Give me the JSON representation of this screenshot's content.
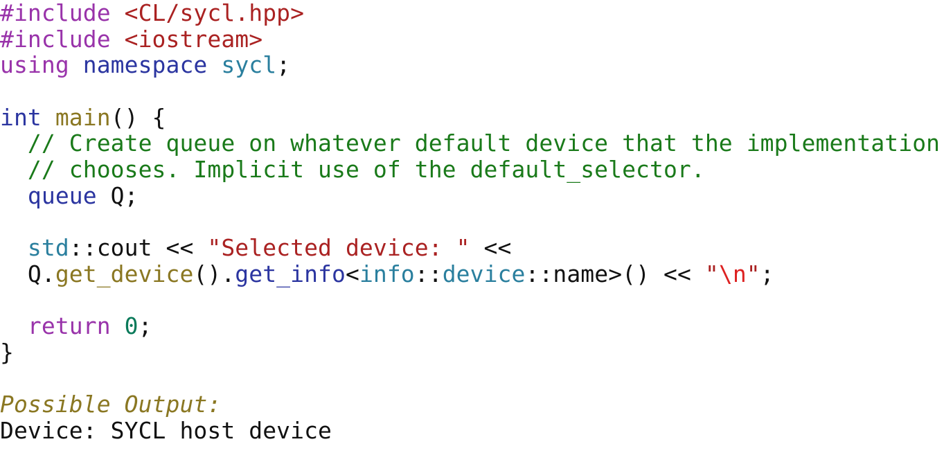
{
  "listing": {
    "language": "cpp",
    "background": "#ffffff",
    "palette": {
      "preprocessor": "#9933aa",
      "keyword": "#9933aa",
      "include_path": "#aa2222",
      "string": "#aa2222",
      "escape": "#dd2222",
      "type": "#2b35a0",
      "namespace": "#2a7f9e",
      "comment": "#1a7a1a",
      "function": "#8a7722",
      "number": "#0a7a5a",
      "plain": "#111111",
      "caption": "#8a7722",
      "output": "#111111"
    },
    "lines": [
      {
        "index": 1,
        "text": "#include <CL/sycl.hpp>",
        "tokens": [
          {
            "t": "#include",
            "c": "t-pre"
          },
          {
            "t": " ",
            "c": "t-plain"
          },
          {
            "t": "<CL/sycl.hpp>",
            "c": "t-inc"
          }
        ]
      },
      {
        "index": 2,
        "text": "#include <iostream>",
        "tokens": [
          {
            "t": "#include",
            "c": "t-pre"
          },
          {
            "t": " ",
            "c": "t-plain"
          },
          {
            "t": "<iostream>",
            "c": "t-inc"
          }
        ]
      },
      {
        "index": 3,
        "text": "using namespace sycl;",
        "tokens": [
          {
            "t": "using",
            "c": "t-kw"
          },
          {
            "t": " ",
            "c": "t-plain"
          },
          {
            "t": "namespace",
            "c": "t-type"
          },
          {
            "t": " ",
            "c": "t-plain"
          },
          {
            "t": "sycl",
            "c": "t-ns"
          },
          {
            "t": ";",
            "c": "t-plain"
          }
        ]
      },
      {
        "index": 4,
        "text": "",
        "tokens": [
          {
            "t": " ",
            "c": "t-blank"
          }
        ]
      },
      {
        "index": 5,
        "text": "int main() {",
        "tokens": [
          {
            "t": "int",
            "c": "t-type"
          },
          {
            "t": " ",
            "c": "t-plain"
          },
          {
            "t": "main",
            "c": "t-fn"
          },
          {
            "t": "() {",
            "c": "t-plain"
          }
        ]
      },
      {
        "index": 6,
        "text": "  // Create queue on whatever default device that the implementation",
        "tokens": [
          {
            "t": "  ",
            "c": "t-plain"
          },
          {
            "t": "// Create queue on whatever default device that the implementation",
            "c": "t-cmt"
          }
        ]
      },
      {
        "index": 7,
        "text": "  // chooses. Implicit use of the default_selector.",
        "tokens": [
          {
            "t": "  ",
            "c": "t-plain"
          },
          {
            "t": "// chooses. Implicit use of the default_selector.",
            "c": "t-cmt"
          }
        ]
      },
      {
        "index": 8,
        "text": "  queue Q;",
        "tokens": [
          {
            "t": "  ",
            "c": "t-plain"
          },
          {
            "t": "queue",
            "c": "t-type"
          },
          {
            "t": " Q;",
            "c": "t-plain"
          }
        ]
      },
      {
        "index": 9,
        "text": "",
        "tokens": [
          {
            "t": " ",
            "c": "t-blank"
          }
        ]
      },
      {
        "index": 10,
        "text": "  std::cout << \"Selected device: \" <<",
        "tokens": [
          {
            "t": "  ",
            "c": "t-plain"
          },
          {
            "t": "std",
            "c": "t-ns"
          },
          {
            "t": "::cout << ",
            "c": "t-plain"
          },
          {
            "t": "\"Selected device: \"",
            "c": "t-str"
          },
          {
            "t": " <<",
            "c": "t-plain"
          }
        ]
      },
      {
        "index": 11,
        "text": "  Q.get_device().get_info<info::device::name>() << \"\\n\";",
        "tokens": [
          {
            "t": "  Q.",
            "c": "t-plain"
          },
          {
            "t": "get_device",
            "c": "t-fn"
          },
          {
            "t": "().",
            "c": "t-plain"
          },
          {
            "t": "get_info",
            "c": "t-type"
          },
          {
            "t": "<",
            "c": "t-plain"
          },
          {
            "t": "info",
            "c": "t-ns"
          },
          {
            "t": "::",
            "c": "t-plain"
          },
          {
            "t": "device",
            "c": "t-ns"
          },
          {
            "t": "::name>() << ",
            "c": "t-plain"
          },
          {
            "t": "\"",
            "c": "t-str"
          },
          {
            "t": "\\n",
            "c": "t-esc"
          },
          {
            "t": "\"",
            "c": "t-str"
          },
          {
            "t": ";",
            "c": "t-plain"
          }
        ]
      },
      {
        "index": 12,
        "text": "",
        "tokens": [
          {
            "t": " ",
            "c": "t-blank"
          }
        ]
      },
      {
        "index": 13,
        "text": "  return 0;",
        "tokens": [
          {
            "t": "  ",
            "c": "t-plain"
          },
          {
            "t": "return",
            "c": "t-kw"
          },
          {
            "t": " ",
            "c": "t-plain"
          },
          {
            "t": "0",
            "c": "t-num"
          },
          {
            "t": ";",
            "c": "t-plain"
          }
        ]
      },
      {
        "index": 14,
        "text": "}",
        "tokens": [
          {
            "t": "}",
            "c": "t-plain"
          }
        ]
      },
      {
        "index": 15,
        "text": "",
        "tokens": [
          {
            "t": " ",
            "c": "t-blank"
          }
        ]
      },
      {
        "index": 16,
        "text": "Possible Output:",
        "tokens": [
          {
            "t": "Possible Output:",
            "c": "t-cap"
          }
        ]
      },
      {
        "index": 17,
        "text": "Device: SYCL host device",
        "tokens": [
          {
            "t": "Device: SYCL host device",
            "c": "t-out"
          }
        ]
      }
    ]
  }
}
